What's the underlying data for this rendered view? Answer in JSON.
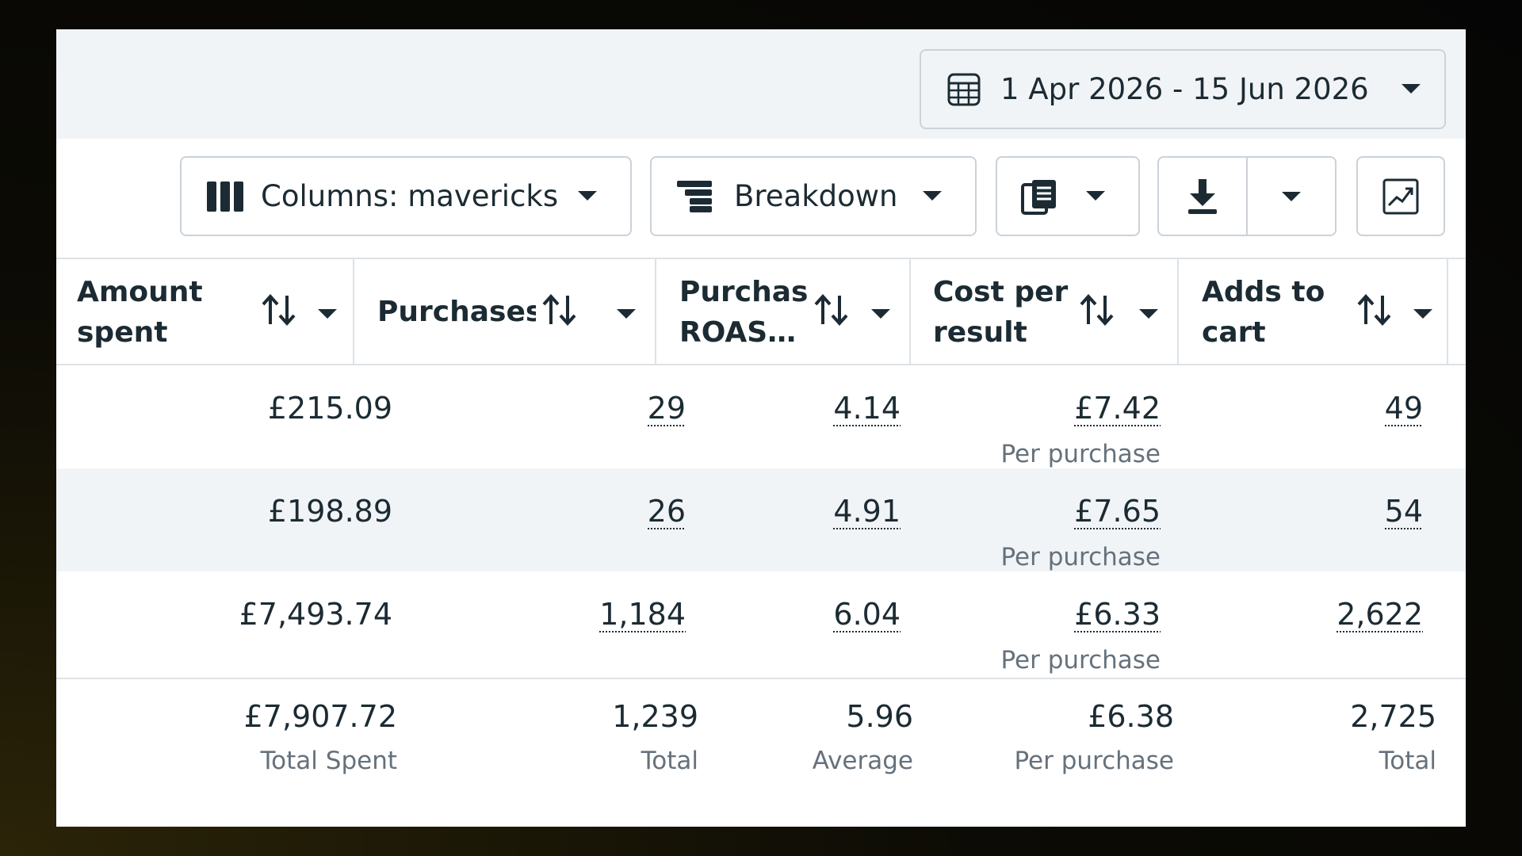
{
  "date_range": {
    "label": "1 Apr 2026 - 15 Jun 2026",
    "icon": "calendar-icon"
  },
  "toolbar": {
    "columns_label": "Columns: mavericks",
    "breakdown_label": "Breakdown",
    "reports_icon": "reports-icon",
    "export_icon": "download-icon",
    "chart_icon": "trend-chart-icon"
  },
  "columns": [
    {
      "title": "Amount\nspent"
    },
    {
      "title": "Purchases"
    },
    {
      "title": "Purchase\nROAS…"
    },
    {
      "title": "Cost per\nresult"
    },
    {
      "title": "Adds to\ncart"
    }
  ],
  "rows": [
    {
      "amount_spent": "£215.09",
      "purchases": "29",
      "roas": "4.14",
      "cost_per_result": "£7.42",
      "cost_sub": "Per purchase",
      "adds_to_cart": "49"
    },
    {
      "amount_spent": "£198.89",
      "purchases": "26",
      "roas": "4.91",
      "cost_per_result": "£7.65",
      "cost_sub": "Per purchase",
      "adds_to_cart": "54"
    },
    {
      "amount_spent": "£7,493.74",
      "purchases": "1,184",
      "roas": "6.04",
      "cost_per_result": "£6.33",
      "cost_sub": "Per purchase",
      "adds_to_cart": "2,622"
    }
  ],
  "totals": {
    "amount_spent": "£7,907.72",
    "amount_spent_sub": "Total Spent",
    "purchases": "1,239",
    "purchases_sub": "Total",
    "roas": "5.96",
    "roas_sub": "Average",
    "cost_per_result": "£6.38",
    "cost_sub": "Per purchase",
    "adds_to_cart": "2,725",
    "adds_to_cart_sub": "Total"
  },
  "colors": {
    "text": "#1c2b33",
    "muted": "#65717c",
    "border": "#cbd2d9",
    "row_alt": "#f1f4f7"
  }
}
